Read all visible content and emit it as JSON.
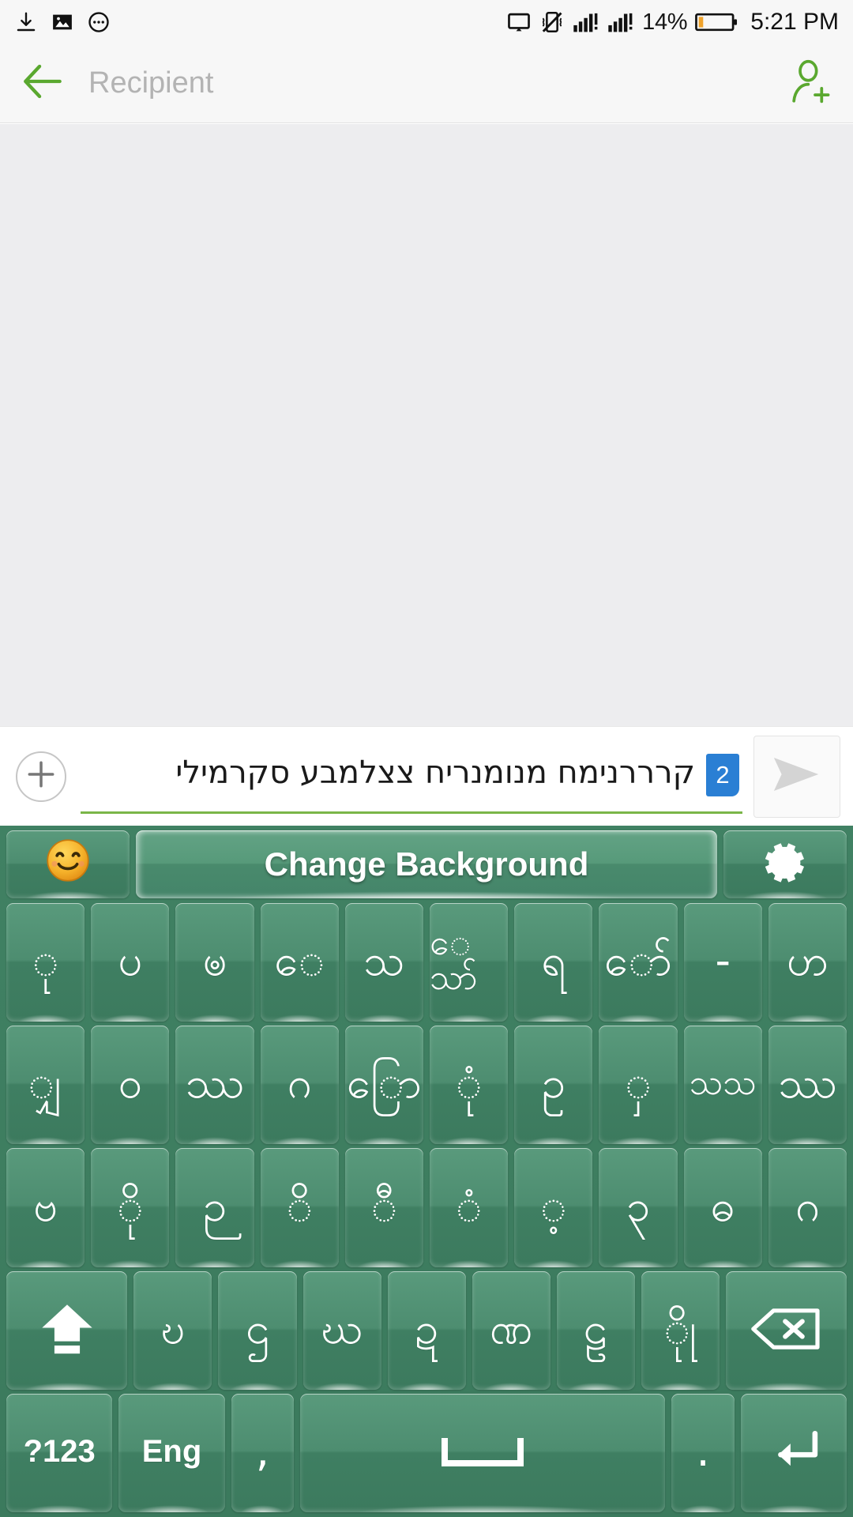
{
  "status_bar": {
    "left_icons": [
      "download-icon",
      "image-icon",
      "more-options-icon"
    ],
    "right_icons": [
      "cast-screen-icon",
      "vibrate-off-icon",
      "signal-sim1-icon",
      "signal-sim2-icon"
    ],
    "battery_percent": "14%",
    "battery_icon": "battery-low-icon",
    "time": "5:21 PM"
  },
  "app_bar": {
    "back_icon": "back-arrow-icon",
    "recipient_placeholder": "Recipient",
    "add_contact_icon": "add-contact-icon",
    "accent_color": "#5aa82f"
  },
  "compose": {
    "attach_icon": "plus-icon",
    "message_text": "קרררנימח מנומנריח צצלמבע  סקרמילי",
    "char_count_badge": "2",
    "badge_color": "#2a7fd4",
    "send_icon": "send-icon",
    "underline_color": "#7ab648"
  },
  "keyboard": {
    "theme_color": "#3e7f62",
    "toolbar": {
      "emoji_icon": "emoji-smiley-icon",
      "change_background_label": "Change Background",
      "settings_icon": "gear-icon"
    },
    "rows": [
      {
        "name": "row-1",
        "keys": [
          {
            "name": "key-u",
            "label": "ု"
          },
          {
            "name": "key-pa",
            "label": "ပ"
          },
          {
            "name": "key-ngu",
            "label": "ၑ"
          },
          {
            "name": "key-e",
            "label": "ေ"
          },
          {
            "name": "key-tha-boxed",
            "label": "သ"
          },
          {
            "name": "key-ethe",
            "label": "ေသာ်"
          },
          {
            "name": "key-ra",
            "label": "ရ"
          },
          {
            "name": "key-ngaw",
            "label": "ော်"
          },
          {
            "name": "key-hyphen",
            "label": "-"
          },
          {
            "name": "key-ha",
            "label": "ဟ"
          }
        ]
      },
      {
        "name": "row-2",
        "keys": [
          {
            "name": "key-hpya",
            "label": "ျှ"
          },
          {
            "name": "key-wa",
            "label": "ဝ"
          },
          {
            "name": "key-hma",
            "label": "ဿ"
          },
          {
            "name": "key-ga",
            "label": "ဂ"
          },
          {
            "name": "key-kyaw",
            "label": "ြော"
          },
          {
            "name": "key-ong",
            "label": "ုံ"
          },
          {
            "name": "key-u2",
            "label": "ဥ"
          },
          {
            "name": "key-sha",
            "label": "ှ"
          },
          {
            "name": "key-thatha",
            "label": "သသ"
          },
          {
            "name": "key-ka",
            "label": "ဿ"
          }
        ]
      },
      {
        "name": "row-3",
        "keys": [
          {
            "name": "key-ba",
            "label": "ဗ"
          },
          {
            "name": "key-dot-below",
            "label": "ို"
          },
          {
            "name": "key-kinzi",
            "label": "ဉ"
          },
          {
            "name": "key-plus-below",
            "label": "ိ"
          },
          {
            "name": "key-ring-below",
            "label": "ီ"
          },
          {
            "name": "key-anusvara",
            "label": "ံ"
          },
          {
            "name": "key-visarga",
            "label": "့"
          },
          {
            "name": "key-three",
            "label": "၃"
          },
          {
            "name": "key-tha2",
            "label": "ဓ"
          },
          {
            "name": "key-na",
            "label": "ဂ"
          }
        ]
      },
      {
        "name": "row-4",
        "keys": [
          {
            "name": "key-shift",
            "label": "",
            "icon": "shift-up-icon",
            "wide": true
          },
          {
            "name": "key-ta",
            "label": "ဎ"
          },
          {
            "name": "key-da",
            "label": "ဌ"
          },
          {
            "name": "key-wa2",
            "label": "ဃ"
          },
          {
            "name": "key-nga",
            "label": "ဍ"
          },
          {
            "name": "key-sa",
            "label": "ဏ"
          },
          {
            "name": "key-la",
            "label": "ဠ"
          },
          {
            "name": "key-htaung",
            "label": "ိုု"
          },
          {
            "name": "key-backspace",
            "label": "",
            "icon": "backspace-icon",
            "wide": true
          }
        ]
      },
      {
        "name": "row-5",
        "keys": [
          {
            "name": "key-symbols",
            "label": "?123"
          },
          {
            "name": "key-language",
            "label": "Eng"
          },
          {
            "name": "key-comma",
            "label": ","
          },
          {
            "name": "key-space",
            "label": "",
            "icon": "space-bar-icon"
          },
          {
            "name": "key-period",
            "label": "."
          },
          {
            "name": "key-enter",
            "label": "",
            "icon": "enter-icon"
          }
        ]
      }
    ]
  }
}
